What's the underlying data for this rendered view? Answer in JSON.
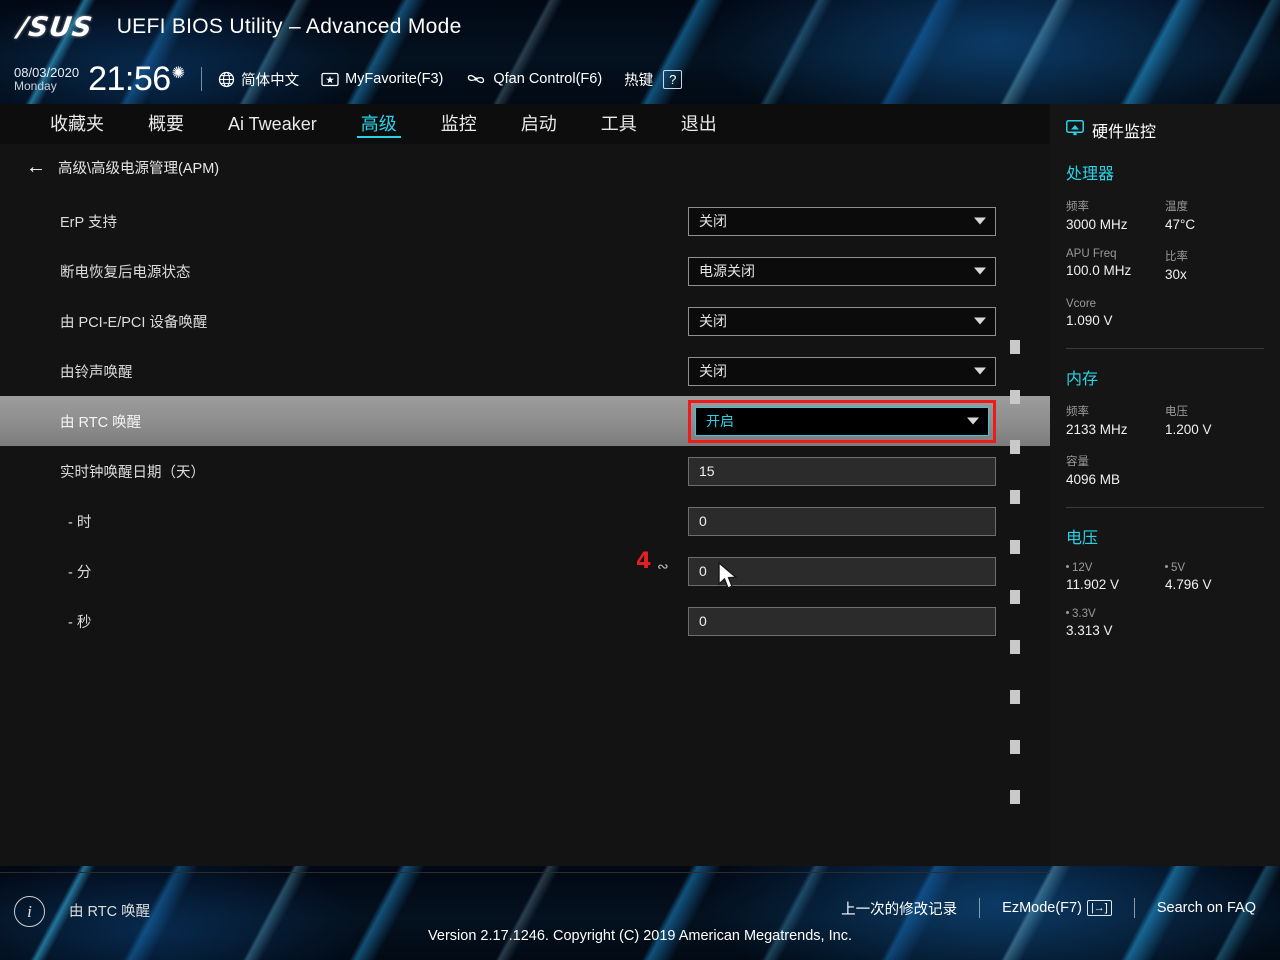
{
  "header": {
    "logo": "/SUS",
    "title": "UEFI BIOS Utility – Advanced Mode",
    "date": "08/03/2020",
    "weekday": "Monday",
    "time": "21:56",
    "gear_icon": "gear-icon",
    "language": {
      "icon": "globe-icon",
      "label": "简体中文"
    },
    "myfavorite": {
      "icon": "star-card-icon",
      "label": "MyFavorite(F3)"
    },
    "qfan": {
      "icon": "fan-icon",
      "label": "Qfan Control(F6)"
    },
    "hotkey": {
      "label": "热键",
      "key": "?"
    }
  },
  "nav": {
    "tabs": [
      {
        "label": "收藏夹",
        "active": false
      },
      {
        "label": "概要",
        "active": false
      },
      {
        "label": "Ai Tweaker",
        "active": false
      },
      {
        "label": "高级",
        "active": true
      },
      {
        "label": "监控",
        "active": false
      },
      {
        "label": "启动",
        "active": false
      },
      {
        "label": "工具",
        "active": false
      },
      {
        "label": "退出",
        "active": false
      }
    ]
  },
  "breadcrumb": {
    "back_icon": "arrow-left-icon",
    "path": "高级\\高级电源管理(APM)"
  },
  "settings": [
    {
      "label": "ErP 支持",
      "type": "select",
      "value": "关闭",
      "selected": false,
      "sub": false
    },
    {
      "label": "断电恢复后电源状态",
      "type": "select",
      "value": "电源关闭",
      "selected": false,
      "sub": false
    },
    {
      "label": "由 PCI-E/PCI 设备唤醒",
      "type": "select",
      "value": "关闭",
      "selected": false,
      "sub": false
    },
    {
      "label": "由铃声唤醒",
      "type": "select",
      "value": "关闭",
      "selected": false,
      "sub": false
    },
    {
      "label": "由 RTC 唤醒",
      "type": "select",
      "value": "开启",
      "selected": true,
      "sub": false
    },
    {
      "label": "实时钟唤醒日期（天）",
      "type": "text",
      "value": "15",
      "selected": false,
      "sub": false
    },
    {
      "label": "- 时",
      "type": "text",
      "value": "0",
      "selected": false,
      "sub": true
    },
    {
      "label": "- 分",
      "type": "text",
      "value": "0",
      "selected": false,
      "sub": true
    },
    {
      "label": "- 秒",
      "type": "text",
      "value": "0",
      "selected": false,
      "sub": true
    }
  ],
  "annotation": {
    "step_number": "4",
    "marker_color": "#ee1b1b",
    "cursor_icon": "mouse-cursor-icon"
  },
  "help": {
    "icon": "info-icon",
    "text": "由 RTC 唤醒"
  },
  "sidebar": {
    "title": "硬件监控",
    "title_icon": "monitor-icon",
    "sections": [
      {
        "name": "处理器",
        "items": [
          {
            "key": "频率",
            "value": "3000 MHz"
          },
          {
            "key": "温度",
            "value": "47°C"
          },
          {
            "key": "APU Freq",
            "value": "100.0 MHz"
          },
          {
            "key": "比率",
            "value": "30x"
          },
          {
            "key": "Vcore",
            "value": "1.090 V",
            "full": true
          }
        ]
      },
      {
        "name": "内存",
        "items": [
          {
            "key": "频率",
            "value": "2133 MHz"
          },
          {
            "key": "电压",
            "value": "1.200 V"
          },
          {
            "key": "容量",
            "value": "4096 MB",
            "full": true
          }
        ]
      },
      {
        "name": "电压",
        "items": [
          {
            "key": "12V",
            "value": "11.902 V",
            "bullet": true
          },
          {
            "key": "5V",
            "value": "4.796 V",
            "bullet": true
          },
          {
            "key": "3.3V",
            "value": "3.313 V",
            "bullet": true,
            "full": true
          }
        ]
      }
    ]
  },
  "footer": {
    "last_modified": "上一次的修改记录",
    "ezmode": "EzMode(F7)",
    "ezmode_icon": "arrow-into-box-icon",
    "search_faq": "Search on FAQ",
    "version": "Version 2.17.1246. Copyright (C) 2019 American Megatrends, Inc."
  },
  "colors": {
    "accent": "#2ad2e8",
    "highlight_red": "#ee1b1b",
    "panel_bg": "#131313",
    "sidebar_bg": "#151515"
  }
}
